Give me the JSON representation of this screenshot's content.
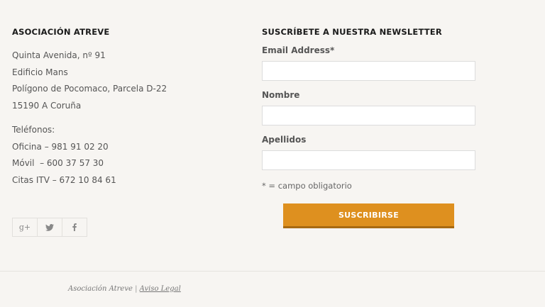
{
  "association": {
    "title": "ASOCIACIÓN ATREVE",
    "address": [
      "Quinta Avenida, nº 91",
      "Edificio Mans",
      "Polígono de Pocomaco, Parcela D-22",
      "15190 A Coruña"
    ],
    "phones_heading": "Teléfonos:",
    "phones": [
      "Oficina – 981 91 02 20",
      "Móvil  – 600 37 57 30",
      "Citas ITV – 672 10 84 61"
    ]
  },
  "social": {
    "google_plus_glyph": "g+",
    "icons": [
      "google-plus-icon",
      "twitter-icon",
      "facebook-icon"
    ]
  },
  "newsletter": {
    "title": "SUSCRÍBETE A NUESTRA NEWSLETTER",
    "email_label": "Email Address*",
    "email_value": "",
    "nombre_label": "Nombre",
    "nombre_value": "",
    "apellidos_label": "Apellidos",
    "apellidos_value": "",
    "required_note": "* = campo obligatorio",
    "submit_label": "SUSCRIBIRSE"
  },
  "footer": {
    "org": "Asociación Atreve",
    "separator": "|",
    "legal_link": "Aviso Legal"
  },
  "colors": {
    "background": "#f7f5f2",
    "button": "#de901f",
    "button_shadow": "#a86a12",
    "heading": "#1a1a1a",
    "text": "#555555"
  }
}
